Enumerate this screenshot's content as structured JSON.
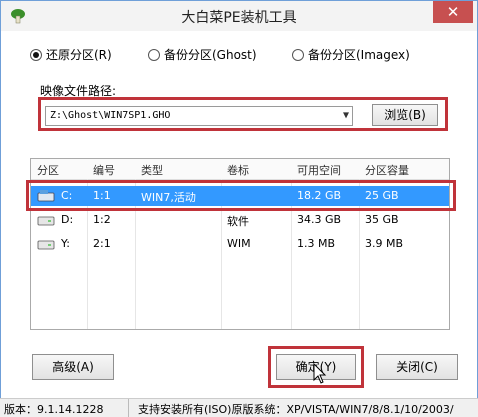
{
  "window": {
    "title": "大白菜PE装机工具",
    "close_label": "✕"
  },
  "modes": [
    {
      "label": "还原分区(R)",
      "selected": true
    },
    {
      "label": "备份分区(Ghost)",
      "selected": false
    },
    {
      "label": "备份分区(Imagex)",
      "selected": false
    }
  ],
  "image_path": {
    "label": "映像文件路径:",
    "value": "Z:\\Ghost\\WIN7SP1.GHO",
    "browse_label": "浏览(B)"
  },
  "table": {
    "columns": [
      "分区",
      "编号",
      "类型",
      "卷标",
      "可用空间",
      "分区容量"
    ],
    "rows": [
      {
        "drive": "C:",
        "num": "1:1",
        "type": "WIN7,活动",
        "label": "",
        "free": "18.2 GB",
        "size": "25 GB",
        "selected": true
      },
      {
        "drive": "D:",
        "num": "1:2",
        "type": "",
        "label": "软件",
        "free": "34.3 GB",
        "size": "35 GB",
        "selected": false
      },
      {
        "drive": "Y:",
        "num": "2:1",
        "type": "",
        "label": "WIM",
        "free": "1.3 MB",
        "size": "3.9 MB",
        "selected": false
      }
    ]
  },
  "buttons": {
    "advanced": "高级(A)",
    "ok": "确定(Y)",
    "close": "关闭(C)"
  },
  "status": {
    "version": "版本：9.1.14.1228",
    "support": "支持安装所有(ISO)原版系统：XP/VISTA/WIN7/8/8.1/10/2003/"
  },
  "colors": {
    "accent": "#3399ff",
    "highlight": "#c0333a"
  }
}
